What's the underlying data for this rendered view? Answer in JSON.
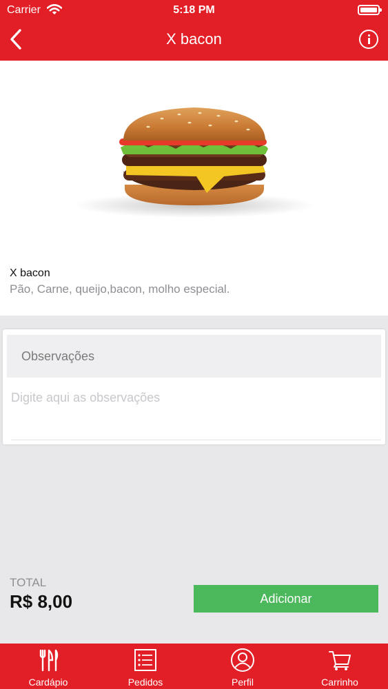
{
  "status_bar": {
    "carrier": "Carrier",
    "time": "5:18 PM"
  },
  "nav": {
    "title": "X bacon",
    "back_icon": "chevron-left-icon",
    "info_icon": "info-icon"
  },
  "product": {
    "name": "X bacon",
    "description": "Pão, Carne, queijo,bacon, molho especial.",
    "image": "burger-photo"
  },
  "observations": {
    "header": "Observações",
    "placeholder": "Digite aqui as observações",
    "value": ""
  },
  "total": {
    "label": "TOTAL",
    "value": "R$ 8,00"
  },
  "add_button": {
    "label": "Adicionar"
  },
  "colors": {
    "brand_red": "#e21e26",
    "add_green": "#4cb85c"
  },
  "tabs": [
    {
      "label": "Cardápio",
      "icon": "fork-knife-icon"
    },
    {
      "label": "Pedidos",
      "icon": "list-icon"
    },
    {
      "label": "Perfil",
      "icon": "user-icon"
    },
    {
      "label": "Carrinho",
      "icon": "cart-icon"
    }
  ]
}
